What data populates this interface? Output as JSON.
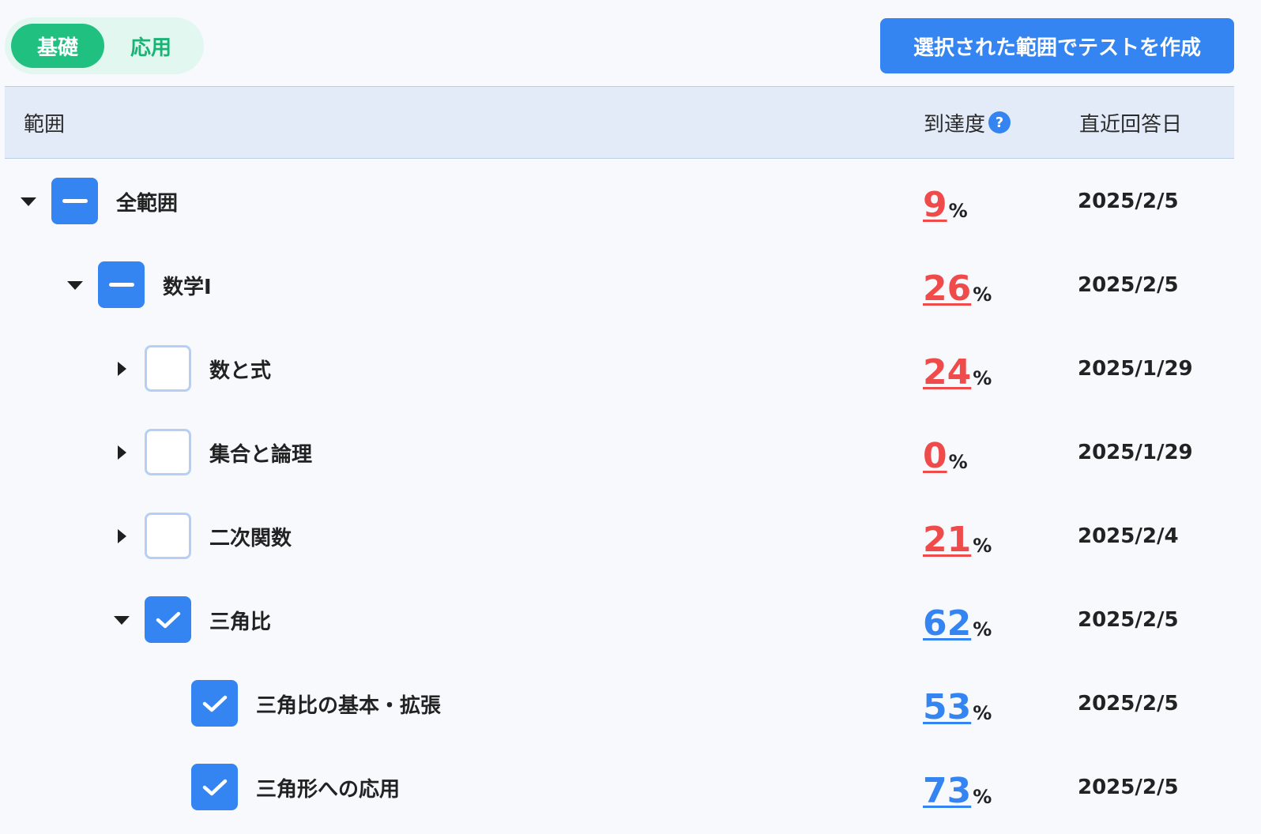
{
  "mode_toggle": {
    "basic_label": "基礎",
    "applied_label": "応用",
    "active": "basic"
  },
  "create_button_label": "選択された範囲でテストを作成",
  "table": {
    "header": {
      "range": "範囲",
      "progress": "到達度",
      "help_icon": "?",
      "last_answer": "直近回答日"
    },
    "rows": [
      {
        "label": "全範囲",
        "level": 0,
        "expanded": true,
        "check": "partial",
        "percent": "9",
        "unit": "%",
        "tone": "low",
        "date": "2025/2/5"
      },
      {
        "label": "数学Ⅰ",
        "level": 1,
        "expanded": true,
        "check": "partial",
        "percent": "26",
        "unit": "%",
        "tone": "low",
        "date": "2025/2/5"
      },
      {
        "label": "数と式",
        "level": 2,
        "expanded": false,
        "check": "unchecked",
        "percent": "24",
        "unit": "%",
        "tone": "low",
        "date": "2025/1/29"
      },
      {
        "label": "集合と論理",
        "level": 2,
        "expanded": false,
        "check": "unchecked",
        "percent": "0",
        "unit": "%",
        "tone": "low",
        "date": "2025/1/29"
      },
      {
        "label": "二次関数",
        "level": 2,
        "expanded": false,
        "check": "unchecked",
        "percent": "21",
        "unit": "%",
        "tone": "low",
        "date": "2025/2/4"
      },
      {
        "label": "三角比",
        "level": 2,
        "expanded": true,
        "check": "checked",
        "percent": "62",
        "unit": "%",
        "tone": "high",
        "date": "2025/2/5"
      },
      {
        "label": "三角比の基本・拡張",
        "level": 3,
        "expanded": null,
        "check": "checked",
        "percent": "53",
        "unit": "%",
        "tone": "high",
        "date": "2025/2/5"
      },
      {
        "label": "三角形への応用",
        "level": 3,
        "expanded": null,
        "check": "checked",
        "percent": "73",
        "unit": "%",
        "tone": "high",
        "date": "2025/2/5"
      }
    ]
  },
  "colors": {
    "primary": "#3485f2",
    "accent_green": "#1fc080",
    "low_score": "#ef4b4b",
    "high_score": "#3485f2"
  }
}
